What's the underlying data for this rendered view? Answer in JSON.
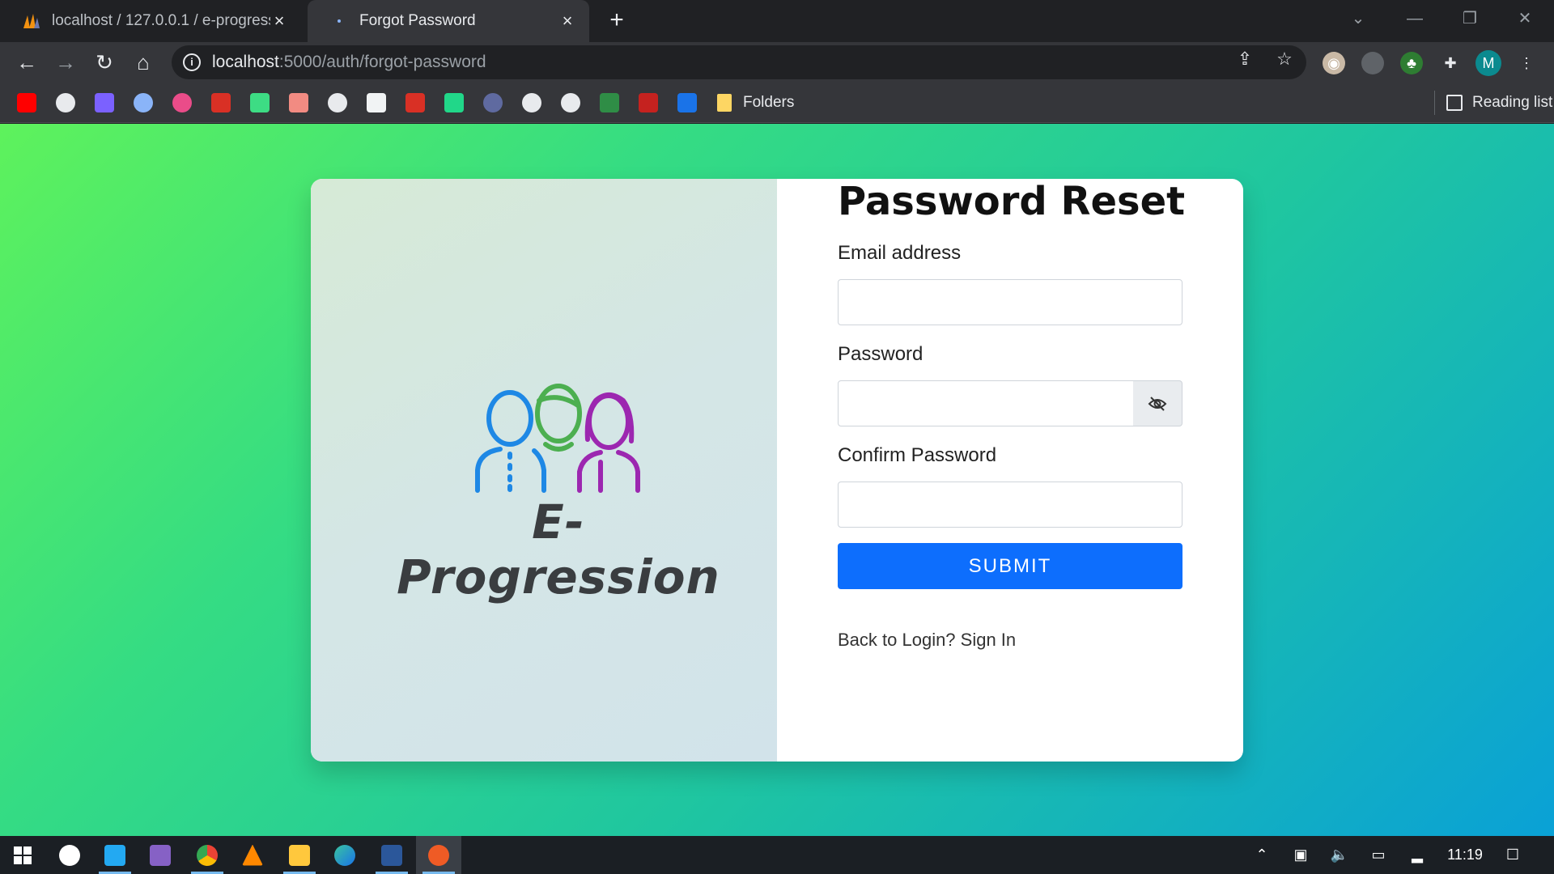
{
  "browser": {
    "tabs": [
      {
        "title": "localhost / 127.0.0.1 / e-progress",
        "active": false,
        "favicon": "phpmyadmin-icon"
      },
      {
        "title": "Forgot Password",
        "active": true,
        "favicon": "page-icon"
      }
    ],
    "url_host": "localhost",
    "url_path": ":5000/auth/forgot-password",
    "bookmarks_folder": "Folders",
    "reading_list": "Reading list",
    "profile_initial": "M"
  },
  "page": {
    "brand_text": "E-Progression",
    "title": "Password Reset",
    "email_label": "Email address",
    "password_label": "Password",
    "confirm_label": "Confirm Password",
    "submit_label": "SUBMIT",
    "back_link": "Back to Login? Sign In",
    "email_value": "",
    "password_value": "",
    "confirm_value": ""
  },
  "taskbar": {
    "time": "11:19"
  },
  "colors": {
    "accent": "#0d6efd",
    "gradient_start": "#5ef25c",
    "gradient_end": "#0aa1d6"
  }
}
